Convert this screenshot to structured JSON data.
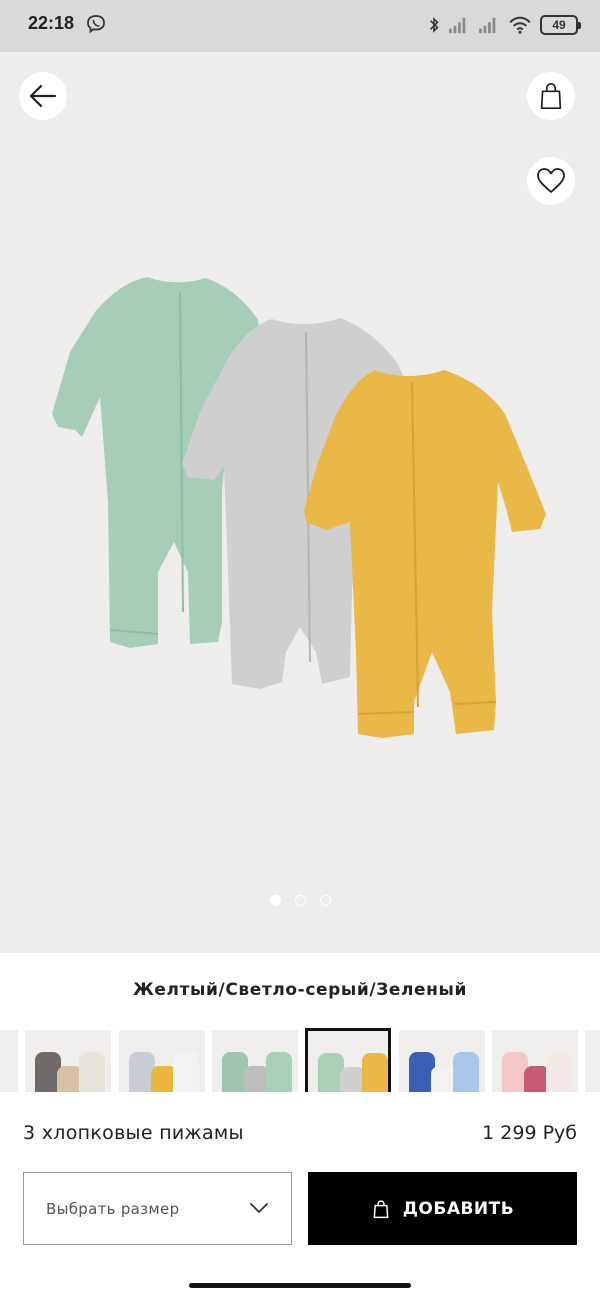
{
  "status_bar": {
    "time": "22:18",
    "battery": "49",
    "icons": [
      "viber-icon",
      "bluetooth-icon",
      "signal-icon",
      "signal-icon",
      "wifi-icon",
      "battery-icon"
    ]
  },
  "gallery": {
    "page_count": 3,
    "current_page": 1,
    "product_colors": [
      "#a6cdb8",
      "#cfcfcf",
      "#e9b847"
    ]
  },
  "color_selector": {
    "selected_name": "Желтый/Светло-серый/Зеленый",
    "swatches": [
      {
        "colors": [
          "#cfcfcf"
        ],
        "selected": false
      },
      {
        "colors": [
          "#6f6a68",
          "#d7c2a8",
          "#e8e4dc"
        ],
        "selected": false
      },
      {
        "colors": [
          "#c9ced6",
          "#e9b73c",
          "#f2f2f2"
        ],
        "selected": false
      },
      {
        "colors": [
          "#9fc7b0",
          "#bdbdbd",
          "#a6d0b7"
        ],
        "selected": false
      },
      {
        "colors": [
          "#a9d0b7",
          "#cfcfcf",
          "#e9b847"
        ],
        "selected": true
      },
      {
        "colors": [
          "#3b5fb5",
          "#f2f2f2",
          "#a8c8ea"
        ],
        "selected": false
      },
      {
        "colors": [
          "#f3c6c8",
          "#c45a73",
          "#f2e8e4"
        ],
        "selected": false
      },
      {
        "colors": [
          "#a6d6c5"
        ],
        "selected": false
      }
    ]
  },
  "product": {
    "name": "3 хлопковые пижамы",
    "price": "1 299 Руб"
  },
  "actions": {
    "size_placeholder": "Выбрать размер",
    "add_label": "ДОБАВИТЬ"
  },
  "colors": {
    "hero_background": "#eeedeb",
    "status_bar": "#d9d9d9",
    "primary_button": "#000000"
  }
}
